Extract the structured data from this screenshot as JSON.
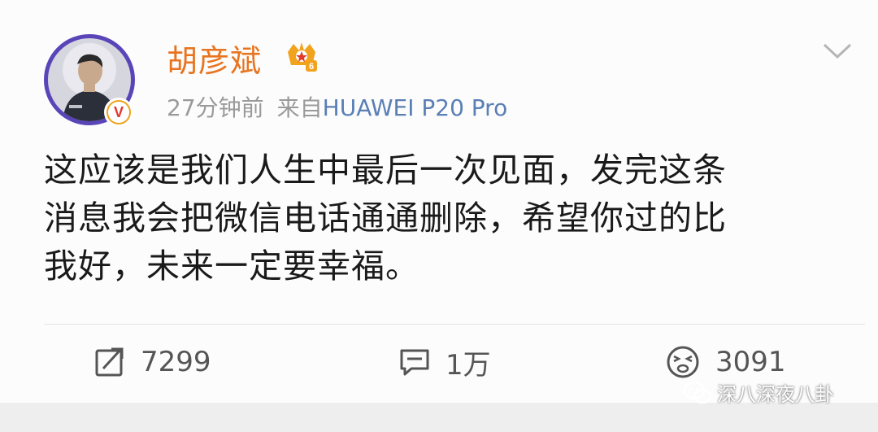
{
  "post": {
    "username": "胡彦斌",
    "vip_level": "6",
    "time_ago": "27分钟前",
    "source_label": "来自",
    "device": "HUAWEI P20 Pro",
    "content": "这应该是我们人生中最后一次见面，发完这条\n消息我会把微信电话通通删除，希望你过的比\n我好，未来一定要幸福。",
    "verified_mark": "V"
  },
  "actions": {
    "repost_count": "7299",
    "comment_count": "1万",
    "like_count": "3091"
  },
  "watermark": {
    "text": "深八深夜八卦"
  },
  "icons": {
    "vip": "vip-crown-icon",
    "menu": "chevron-down-icon",
    "repost": "repost-icon",
    "comment": "comment-icon",
    "like": "emoji-face-icon",
    "watermark": "wechat-logo-icon"
  },
  "colors": {
    "username": "#e8741f",
    "device": "#5a7fb5",
    "meta": "#9a9a9a",
    "avatar_ring": "#5a45b8",
    "verified_badge": "#f0a21d"
  }
}
